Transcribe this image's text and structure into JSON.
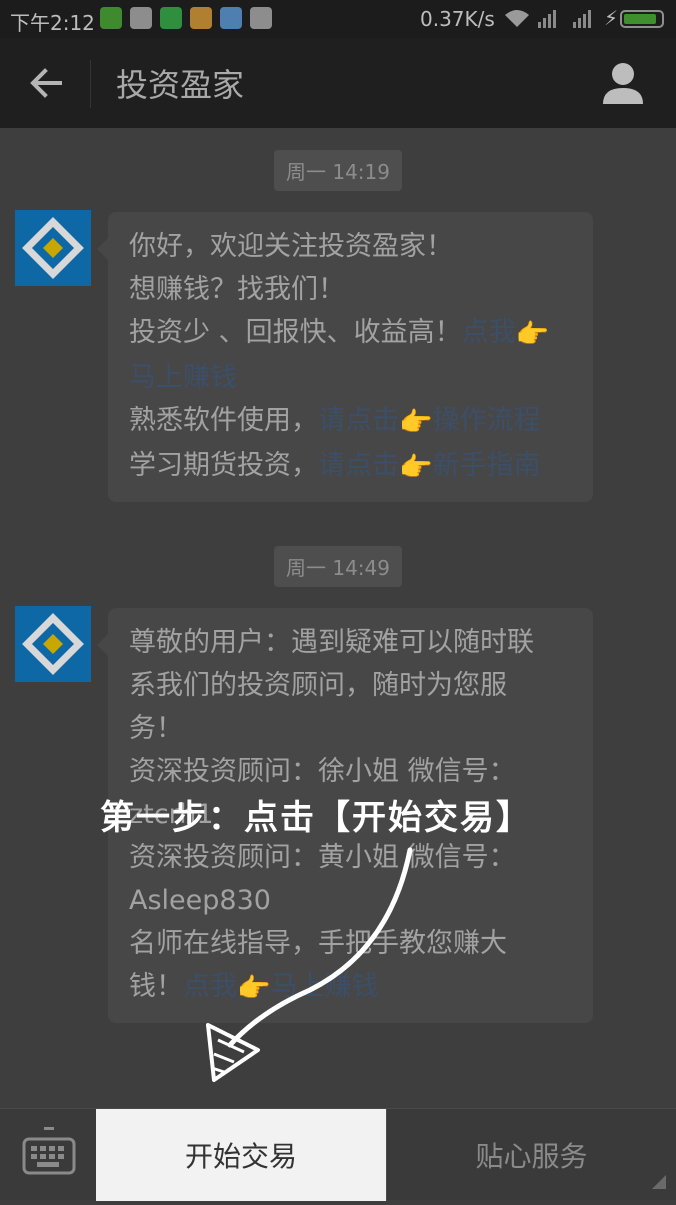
{
  "status_bar": {
    "time": "下午2:12",
    "network_speed": "0.37K/s",
    "battery_level": 0.9
  },
  "header": {
    "title": "投资盈家"
  },
  "messages": [
    {
      "timestamp": "周一 14:19",
      "lines": [
        {
          "text": "你好，欢迎关注投资盈家！"
        },
        {
          "text": "想赚钱？找我们！"
        },
        {
          "text": "投资少 、回报快、收益高！",
          "link": "点我",
          "emoji": "👉",
          "link2": ""
        },
        {
          "text": "",
          "link": "马上赚钱"
        },
        {
          "text": "熟悉软件使用，",
          "link": "请点击",
          "emoji": "👉",
          "link2": "操作流程"
        },
        {
          "text": "学习期货投资，",
          "link": "请点击",
          "emoji": "👉",
          "link2": "新手指南"
        }
      ]
    },
    {
      "timestamp": "周一 14:49",
      "lines": [
        {
          "text": "尊敬的用户：遇到疑难可以随时联"
        },
        {
          "text": "系我们的投资顾问，随时为您服"
        },
        {
          "text": "务！"
        },
        {
          "text": "资深投资顾问：徐小姐  微信号："
        },
        {
          "text": "ztcrh1"
        },
        {
          "text": "资深投资顾问：黄小姐  微信号："
        },
        {
          "text": "Asleep830"
        },
        {
          "text": "名师在线指导，手把手教您赚大"
        },
        {
          "text": "钱！",
          "link": "点我",
          "emoji": "👉",
          "link2": "马上赚钱"
        }
      ]
    }
  ],
  "overlay": {
    "instruction": "第一步：点击【开始交易】"
  },
  "bottom_menu": {
    "items": [
      "开始交易",
      "贴心服务"
    ]
  },
  "icons": [
    "back-arrow-icon",
    "profile-icon",
    "keyboard-icon",
    "wifi-icon",
    "battery-icon"
  ]
}
